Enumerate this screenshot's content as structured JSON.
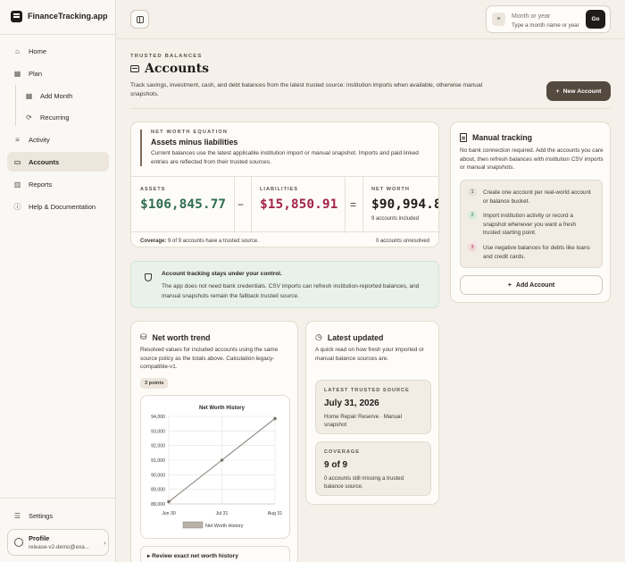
{
  "app": {
    "name": "FinanceTracking.app"
  },
  "sidebar": {
    "items": [
      {
        "label": "Home",
        "icon": "home-icon"
      },
      {
        "label": "Plan",
        "icon": "calendar-icon"
      },
      {
        "label": "Add Month",
        "icon": "calendar-plus-icon"
      },
      {
        "label": "Recurring",
        "icon": "refresh-icon"
      },
      {
        "label": "Activity",
        "icon": "list-icon"
      },
      {
        "label": "Accounts",
        "icon": "wallet-icon",
        "active": true
      },
      {
        "label": "Reports",
        "icon": "bar-chart-icon"
      },
      {
        "label": "Help & Documentation",
        "icon": "help-icon"
      }
    ],
    "settings_label": "Settings",
    "profile": {
      "name": "Profile",
      "email": "release-v2-demo@exa..."
    }
  },
  "topbar": {
    "period_placeholder": "Month or year",
    "period_hint": "Type a month name or year",
    "go_label": "Go"
  },
  "header": {
    "eyebrow": "TRUSTED BALANCES",
    "title": "Accounts",
    "description": "Track savings, investment, cash, and debt balances from the latest trusted source: institution imports when available, otherwise manual snapshots.",
    "new_account_label": "New Account"
  },
  "net_worth": {
    "eyebrow": "NET WORTH EQUATION",
    "title": "Assets minus liabilities",
    "description": "Current balances use the latest applicable institution import or manual snapshot. Imports and paid linked entries are reflected from their trusted sources.",
    "assets_label": "ASSETS",
    "assets_value": "$106,845.77",
    "minus_symbol": "−",
    "liabilities_label": "LIABILITIES",
    "liabilities_value": "$15,850.91",
    "equals_symbol": "=",
    "net_label": "NET WORTH",
    "net_value": "$90,994.8",
    "accounts_included": "9 accounts included",
    "coverage_label": "Coverage:",
    "coverage_text": "9 of 9 accounts have a trusted source.",
    "unresolved_text": "0 accounts unresolved",
    "assets_color": "#2f6e4e",
    "liabilities_color": "#a4244a"
  },
  "manual_tracking": {
    "title": "Manual tracking",
    "description": "No bank connection required. Add the accounts you care about, then refresh balances with institution CSV imports or manual snapshots.",
    "steps": [
      {
        "num": "1",
        "text": "Create one account per real-world account or balance bucket."
      },
      {
        "num": "2",
        "text": "Import institution activity or record a snapshot whenever you want a fresh trusted starting point."
      },
      {
        "num": "3",
        "text": "Use negative balances for debts like loans and credit cards."
      }
    ],
    "add_account_label": "Add Account"
  },
  "notice": {
    "title": "Account tracking stays under your control.",
    "text": "The app does not need bank credentials. CSV imports can refresh institution-reported balances, and manual snapshots remain the fallback trusted source."
  },
  "trend": {
    "title": "Net worth trend",
    "description": "Resolved values for included accounts using the same source policy as the totals above. Calculation legacy-compatible-v1.",
    "points_badge": "3 points",
    "review_label": "▸ Review exact net worth history"
  },
  "chart_data": {
    "type": "line",
    "title": "Net Worth History",
    "categories": [
      "Jun 30",
      "Jul 31",
      "Aug 31"
    ],
    "series": [
      {
        "name": "Net Worth History",
        "values": [
          88150,
          91000,
          93850
        ]
      }
    ],
    "ylim": [
      88000,
      94000
    ],
    "yticks": [
      "94,000",
      "93,000",
      "92,000",
      "91,000",
      "90,000",
      "89,000",
      "88,000"
    ],
    "xlabel": "",
    "ylabel": "",
    "grid": true,
    "legend": "bottom",
    "line_color": "#8a857f",
    "legend_color": "#b9b2a6"
  },
  "latest": {
    "title": "Latest updated",
    "description": "A quick read on how fresh your imported or manual balance sources are.",
    "trusted_label": "LATEST TRUSTED SOURCE",
    "trusted_date": "July 31, 2026",
    "trusted_sub": "Home Repair Reserve · Manual snapshot",
    "coverage_label": "COVERAGE",
    "coverage_value": "9 of 9",
    "coverage_sub": "0 accounts still missing a trusted balance source."
  }
}
